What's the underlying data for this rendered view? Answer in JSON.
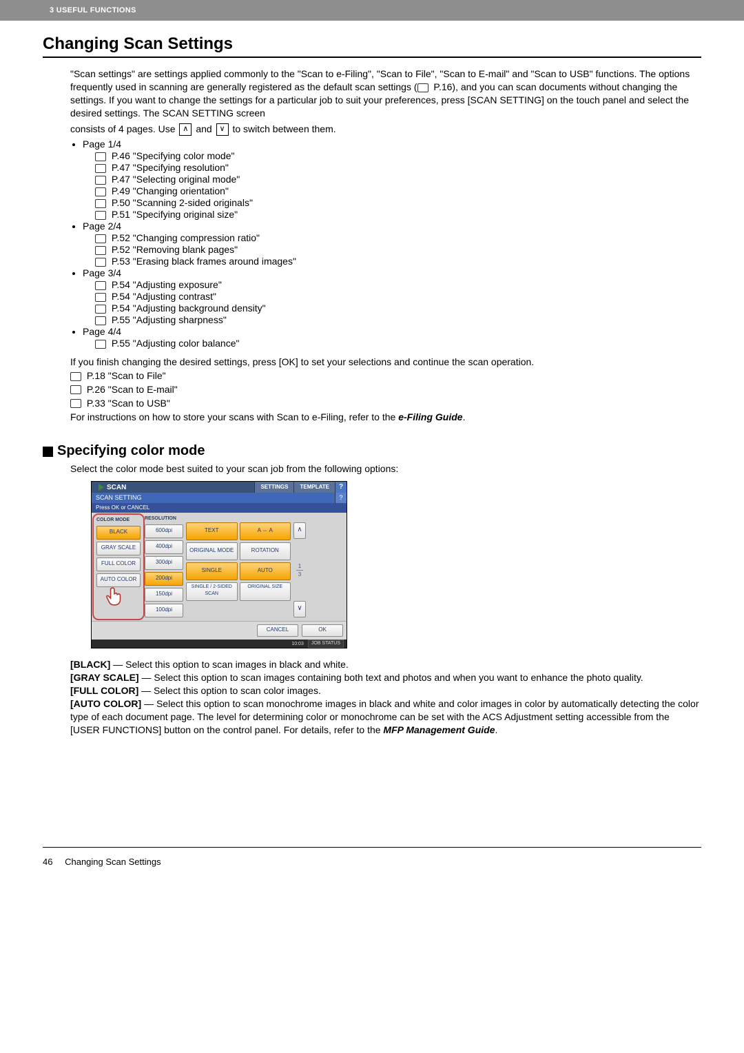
{
  "header": {
    "chapter": "3 USEFUL FUNCTIONS"
  },
  "title": "Changing Scan Settings",
  "intro": {
    "p1": "\"Scan settings\" are settings applied commonly to the \"Scan to e-Filing\", \"Scan to File\", \"Scan to E-mail\" and \"Scan to USB\" functions. The options frequently used in scanning are generally registered as the default scan settings (",
    "p1_ref": " P.16), and you can scan documents without changing the settings. If you want to change the settings for a particular job to suit your preferences, press [SCAN SETTING] on the touch panel and select the desired settings. The SCAN SETTING screen",
    "p2a": "consists of 4 pages. Use ",
    "p2b": " and ",
    "p2c": " to switch between them."
  },
  "pages": [
    {
      "label": "Page 1/4",
      "items": [
        "P.46 \"Specifying color mode\"",
        "P.47 \"Specifying resolution\"",
        "P.47 \"Selecting original mode\"",
        "P.49 \"Changing orientation\"",
        "P.50 \"Scanning 2-sided originals\"",
        "P.51 \"Specifying original size\""
      ]
    },
    {
      "label": "Page 2/4",
      "items": [
        "P.52 \"Changing compression ratio\"",
        "P.52 \"Removing blank pages\"",
        "P.53 \"Erasing black frames around images\""
      ]
    },
    {
      "label": "Page 3/4",
      "items": [
        "P.54 \"Adjusting exposure\"",
        "P.54 \"Adjusting contrast\"",
        "P.54 \"Adjusting background density\"",
        "P.55 \"Adjusting sharpness\""
      ]
    },
    {
      "label": "Page 4/4",
      "items": [
        "P.55 \"Adjusting color balance\""
      ]
    }
  ],
  "finish_text": "If you finish changing the desired settings, press [OK] to set your selections and continue the scan operation.",
  "refs": [
    "P.18 \"Scan to File\"",
    "P.26 \"Scan to E-mail\"",
    "P.33 \"Scan to USB\""
  ],
  "efile_a": "For instructions on how to store your scans with Scan to e-Filing, refer to the ",
  "efile_b": "e-Filing Guide",
  "efile_c": ".",
  "sub_heading": "Specifying color mode",
  "sub_intro": "Select the color mode best suited to your scan job from the following options:",
  "panel": {
    "title": "SCAN",
    "settings": "SETTINGS",
    "template": "TEMPLATE",
    "help": "?",
    "subtitle": "SCAN SETTING",
    "note": "Press OK or CANCEL",
    "head_color": "COLOR MODE",
    "head_res": "RESOLUTION",
    "color_modes": [
      "BLACK",
      "GRAY SCALE",
      "FULL COLOR",
      "AUTO COLOR"
    ],
    "resolutions": [
      "600dpi",
      "400dpi",
      "300dpi",
      "200dpi",
      "150dpi",
      "100dpi"
    ],
    "wide": {
      "text": "TEXT",
      "aa": "A ⇔ A",
      "original_mode": "ORIGINAL MODE",
      "rotation": "ROTATION",
      "single": "SINGLE",
      "auto": "AUTO",
      "single2": "SINGLE / 2-SIDED SCAN",
      "original_size": "ORIGINAL SIZE"
    },
    "page_top": "1",
    "page_bottom": "3",
    "up": "∧",
    "down": "∨",
    "cancel": "CANCEL",
    "ok": "OK",
    "clock": "10:03",
    "jobstatus": "JOB STATUS"
  },
  "desc": {
    "black_h": "[BLACK]",
    "black_t": " — Select this option to scan images in black and white.",
    "gray_h": "[GRAY SCALE]",
    "gray_t": " — Select this option to scan images containing both text and photos and when you want to enhance the photo quality.",
    "full_h": "[FULL COLOR]",
    "full_t": " — Select this option to scan color images.",
    "auto_h": "[AUTO COLOR]",
    "auto_t": " — Select this option to scan monochrome images in black and white and color images in color by automatically detecting the color type of each document page. The level for determining color or monochrome can be set with the ACS Adjustment setting accessible from the [USER FUNCTIONS] button on the control panel. For details, refer to the ",
    "auto_g": "MFP Management Guide",
    "auto_e": "."
  },
  "footer": {
    "page": "46",
    "title": "Changing Scan Settings"
  }
}
